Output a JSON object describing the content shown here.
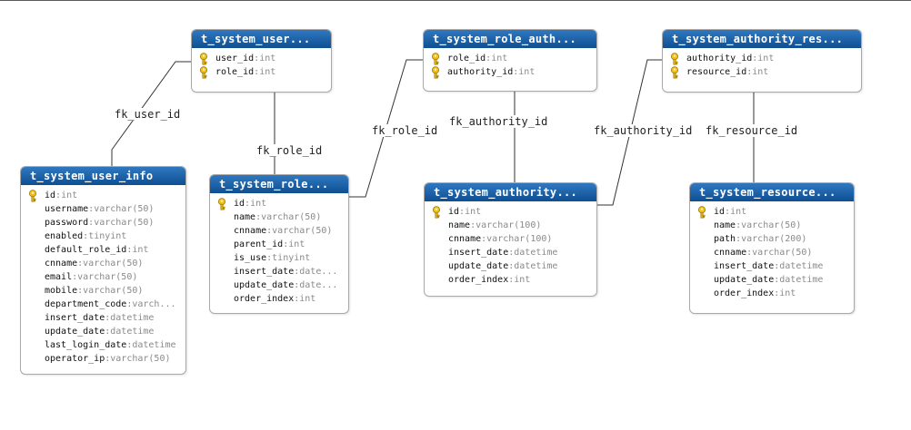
{
  "relationships": [
    {
      "label": "fk_user_id"
    },
    {
      "label": "fk_role_id"
    },
    {
      "label": "fk_role_id"
    },
    {
      "label": "fk_authority_id"
    },
    {
      "label": "fk_authority_id"
    },
    {
      "label": "fk_resource_id"
    }
  ],
  "tables": [
    {
      "title": "t_system_user...",
      "columns": [
        {
          "name": "user_id",
          "type": "int",
          "key": true
        },
        {
          "name": "role_id",
          "type": "int",
          "key": true
        }
      ]
    },
    {
      "title": "t_system_role_auth...",
      "columns": [
        {
          "name": "role_id",
          "type": "int",
          "key": true
        },
        {
          "name": "authority_id",
          "type": "int",
          "key": true
        }
      ]
    },
    {
      "title": "t_system_authority_res...",
      "columns": [
        {
          "name": "authority_id",
          "type": "int",
          "key": true
        },
        {
          "name": "resource_id",
          "type": "int",
          "key": true
        }
      ]
    },
    {
      "title": "t_system_user_info",
      "columns": [
        {
          "name": "id",
          "type": "int",
          "key": true
        },
        {
          "name": "username",
          "type": "varchar(50)"
        },
        {
          "name": "password",
          "type": "varchar(50)"
        },
        {
          "name": "enabled",
          "type": "tinyint"
        },
        {
          "name": "default_role_id",
          "type": "int"
        },
        {
          "name": "cnname",
          "type": "varchar(50)"
        },
        {
          "name": "email",
          "type": "varchar(50)"
        },
        {
          "name": "mobile",
          "type": "varchar(50)"
        },
        {
          "name": "department_code",
          "type": "varch..."
        },
        {
          "name": "insert_date",
          "type": "datetime"
        },
        {
          "name": "update_date",
          "type": "datetime"
        },
        {
          "name": "last_login_date",
          "type": "datetime"
        },
        {
          "name": "operator_ip",
          "type": "varchar(50)"
        }
      ]
    },
    {
      "title": "t_system_role...",
      "columns": [
        {
          "name": "id",
          "type": "int",
          "key": true
        },
        {
          "name": "name",
          "type": "varchar(50)"
        },
        {
          "name": "cnname",
          "type": "varchar(50)"
        },
        {
          "name": "parent_id",
          "type": "int"
        },
        {
          "name": "is_use",
          "type": "tinyint"
        },
        {
          "name": "insert_date",
          "type": "date..."
        },
        {
          "name": "update_date",
          "type": "date..."
        },
        {
          "name": "order_index",
          "type": "int"
        }
      ]
    },
    {
      "title": "t_system_authority...",
      "columns": [
        {
          "name": "id",
          "type": "int",
          "key": true
        },
        {
          "name": "name",
          "type": "varchar(100)"
        },
        {
          "name": "cnname",
          "type": "varchar(100)"
        },
        {
          "name": "insert_date",
          "type": "datetime"
        },
        {
          "name": "update_date",
          "type": "datetime"
        },
        {
          "name": "order_index",
          "type": "int"
        }
      ]
    },
    {
      "title": "t_system_resource...",
      "columns": [
        {
          "name": "id",
          "type": "int",
          "key": true
        },
        {
          "name": "name",
          "type": "varchar(50)"
        },
        {
          "name": "path",
          "type": "varchar(200)"
        },
        {
          "name": "cnname",
          "type": "varchar(50)"
        },
        {
          "name": "insert_date",
          "type": "datetime"
        },
        {
          "name": "update_date",
          "type": "datetime"
        },
        {
          "name": "order_index",
          "type": "int"
        }
      ]
    }
  ]
}
